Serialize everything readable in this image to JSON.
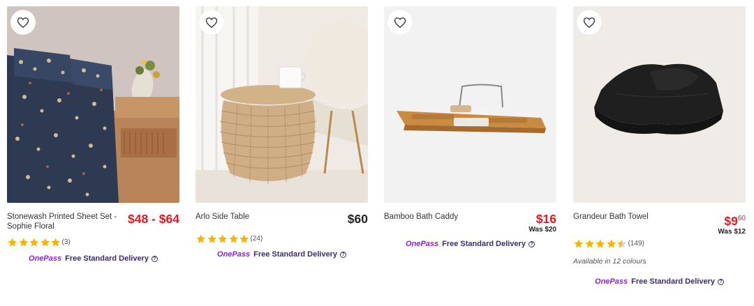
{
  "products": [
    {
      "name": "Stonewash Printed Sheet Set - Sophie Floral",
      "price": "$48 - $64",
      "rating": 5,
      "review_count": "(3)",
      "delivery_brand": "OnePass",
      "delivery_text": "Free Standard Delivery",
      "wishlist_icon": "heart-outline-icon"
    },
    {
      "name": "Arlo Side Table",
      "price": "$60",
      "rating": 5,
      "review_count": "(24)",
      "delivery_brand": "OnePass",
      "delivery_text": "Free Standard Delivery",
      "wishlist_icon": "heart-outline-icon"
    },
    {
      "name": "Bamboo Bath Caddy",
      "price": "$16",
      "was_price": "Was $20",
      "delivery_brand": "OnePass",
      "delivery_text": "Free Standard Delivery",
      "wishlist_icon": "heart-outline-icon"
    },
    {
      "name": "Grandeur Bath Towel",
      "price_main": "$9",
      "price_cents": "60",
      "was_price": "Was $12",
      "rating": 4.5,
      "review_count": "(149)",
      "colours_text": "Available in 12 colours",
      "delivery_brand": "OnePass",
      "delivery_text": "Free Standard Delivery",
      "wishlist_icon": "heart-outline-icon"
    }
  ],
  "colors": {
    "sale_red": "#e01a22",
    "onepass_purple": "#8a1fd6",
    "delivery_navy": "#3b2a73",
    "star_gold": "#f4b400"
  }
}
